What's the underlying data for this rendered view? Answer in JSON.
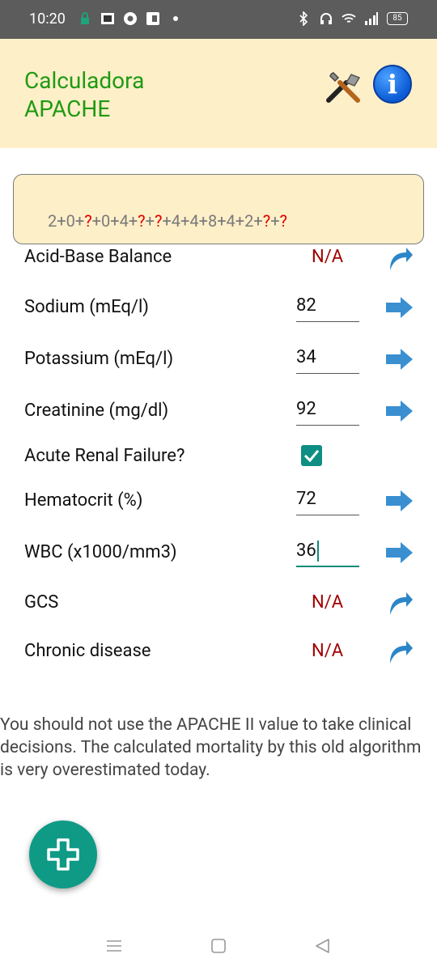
{
  "status_bar": {
    "time": "10:20",
    "battery": "85"
  },
  "header": {
    "title": "Calculadora\nAPACHE"
  },
  "score": {
    "parts": [
      "2+0+",
      "?",
      "+0+4+",
      "?",
      "+",
      "?",
      "+4+4+8+4+2+",
      "?",
      "+",
      "?"
    ]
  },
  "rows": [
    {
      "label": "Acid-Base Balance",
      "value": "N/A"
    },
    {
      "label": "Sodium (mEq/l)",
      "value": "82"
    },
    {
      "label": "Potassium (mEq/l)",
      "value": "34"
    },
    {
      "label": "Creatinine (mg/dl)",
      "value": "92"
    },
    {
      "label": "Acute Renal Failure?",
      "checked": true
    },
    {
      "label": "Hematocrit (%)",
      "value": "72"
    },
    {
      "label": "WBC (x1000/mm3)",
      "value": "36"
    },
    {
      "label": "GCS",
      "value": "N/A"
    },
    {
      "label": "Chronic disease",
      "value": "N/A"
    }
  ],
  "disclaimer": "You should not use the APACHE II value to take clinical decisions. The calculated mortality by this old algorithm is very overestimated today.",
  "colors": {
    "title": "#1f9a13",
    "header_bg": "#fdefc8",
    "na": "#a00000",
    "accent": "#0f9a86",
    "arrow": "#3a8fd1"
  },
  "icons": [
    "tools-icon",
    "info-icon",
    "arrow-right-icon",
    "curved-arrow-icon",
    "check-icon",
    "plus-icon",
    "menu-icon",
    "home-icon",
    "back-icon"
  ]
}
